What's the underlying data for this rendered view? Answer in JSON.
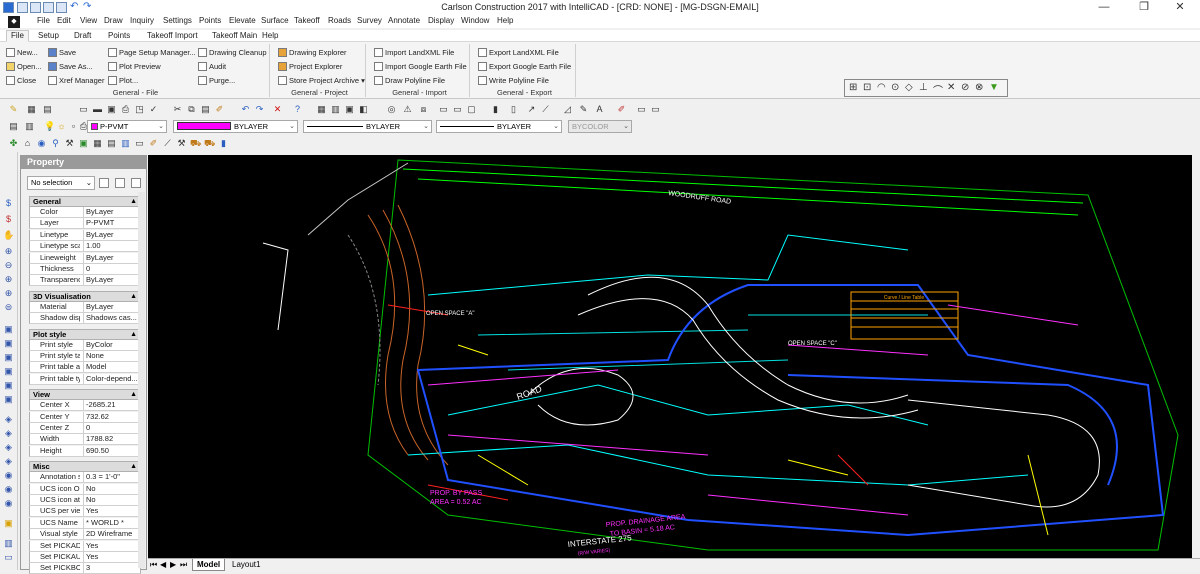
{
  "window": {
    "title": "Carlson Construction 2017 with IntelliCAD - [CRD: NONE] - [MG-DSGN-EMAIL]",
    "minimize": "—",
    "restore": "❐",
    "close": "✕"
  },
  "menu": [
    "File",
    "Edit",
    "View",
    "Draw",
    "Inquiry",
    "Settings",
    "Points",
    "Elevate",
    "Surface",
    "Takeoff",
    "Roads",
    "Survey",
    "Annotate",
    "Display",
    "Window",
    "Help"
  ],
  "ribbon_tabs": [
    "File",
    "Setup",
    "Draft",
    "Points",
    "Takeoff Import",
    "Takeoff Main",
    "Help"
  ],
  "ribbon": {
    "general_file": {
      "title": "General - File",
      "new": "New...",
      "open": "Open...",
      "close": "Close",
      "save": "Save",
      "save_as": "Save As...",
      "xref": "Xref Manager",
      "page_setup": "Page Setup Manager...",
      "plot_preview": "Plot Preview",
      "plot": "Plot...",
      "drawing_cleanup": "Drawing Cleanup",
      "audit": "Audit",
      "purge": "Purge..."
    },
    "general_project": {
      "title": "General - Project",
      "drawing_explorer": "Drawing Explorer",
      "project_explorer": "Project Explorer",
      "store_archive": "Store Project Archive"
    },
    "general_import": {
      "title": "General - Import",
      "import_landxml": "Import LandXML File",
      "import_google": "Import Google Earth File",
      "draw_polyline": "Draw Polyline File"
    },
    "general_export": {
      "title": "General - Export",
      "export_landxml": "Export LandXML File",
      "export_google": "Export Google Earth File",
      "write_polyline": "Write Polyline File"
    }
  },
  "toolbar": {
    "layer": "P-PVMT",
    "color": "BYLAYER",
    "linetype": "BYLAYER",
    "lineweight": "BYLAYER",
    "plotstyle": "BYCOLOR",
    "color_swatch": "#ff00ff"
  },
  "property": {
    "title": "Property",
    "selection": "No selection",
    "sections": [
      {
        "name": "General",
        "rows": [
          {
            "k": "Color",
            "v": "ByLayer"
          },
          {
            "k": "Layer",
            "v": "P-PVMT"
          },
          {
            "k": "Linetype",
            "v": "ByLayer"
          },
          {
            "k": "Linetype scale",
            "v": "1.00"
          },
          {
            "k": "Lineweight",
            "v": "ByLayer"
          },
          {
            "k": "Thickness",
            "v": "0"
          },
          {
            "k": "Transparency",
            "v": "ByLayer"
          }
        ]
      },
      {
        "name": "3D Visualisation",
        "rows": [
          {
            "k": "Material",
            "v": "ByLayer"
          },
          {
            "k": "Shadow displ...",
            "v": "Shadows cas..."
          }
        ]
      },
      {
        "name": "Plot style",
        "rows": [
          {
            "k": "Print style",
            "v": "ByColor"
          },
          {
            "k": "Print style table",
            "v": "None"
          },
          {
            "k": "Print table att...",
            "v": "Model"
          },
          {
            "k": "Print table type",
            "v": "Color-depend..."
          }
        ]
      },
      {
        "name": "View",
        "rows": [
          {
            "k": "Center X",
            "v": "-2685.21"
          },
          {
            "k": "Center Y",
            "v": "732.62"
          },
          {
            "k": "Center Z",
            "v": "0"
          },
          {
            "k": "Width",
            "v": "1788.82"
          },
          {
            "k": "Height",
            "v": "690.50"
          }
        ]
      },
      {
        "name": "Misc",
        "rows": [
          {
            "k": "Annotation s...",
            "v": "0.3 = 1'-0\""
          },
          {
            "k": "UCS icon On",
            "v": "No"
          },
          {
            "k": "UCS icon at ...",
            "v": "No"
          },
          {
            "k": "UCS per vie...",
            "v": "Yes"
          },
          {
            "k": "UCS Name",
            "v": "* WORLD *"
          },
          {
            "k": "Visual style",
            "v": "2D Wireframe"
          },
          {
            "k": "Set PICKADD",
            "v": "Yes"
          },
          {
            "k": "Set PICKAUTO",
            "v": "Yes"
          },
          {
            "k": "Set PICKBOX",
            "v": "3"
          }
        ]
      }
    ]
  },
  "drawing": {
    "labels": {
      "woodruff": "WOODRUFF ROAD",
      "open_a": "OPEN SPACE \"A\"",
      "open_c": "OPEN SPACE \"C\"",
      "road": "ROAD",
      "bypass1": "PROP. BY PASS",
      "bypass2": "AREA = 0.52 AC",
      "drainage1": "PROP. DRAINAGE AREA",
      "drainage2": "TO BASIN = 5.18 AC",
      "interstate": "INTERSTATE 275",
      "interstate_sub": "(R/W VARIES)",
      "table_title": "Curve / Line Table"
    }
  },
  "layout_tabs": {
    "model": "Model",
    "layout1": "Layout1"
  }
}
